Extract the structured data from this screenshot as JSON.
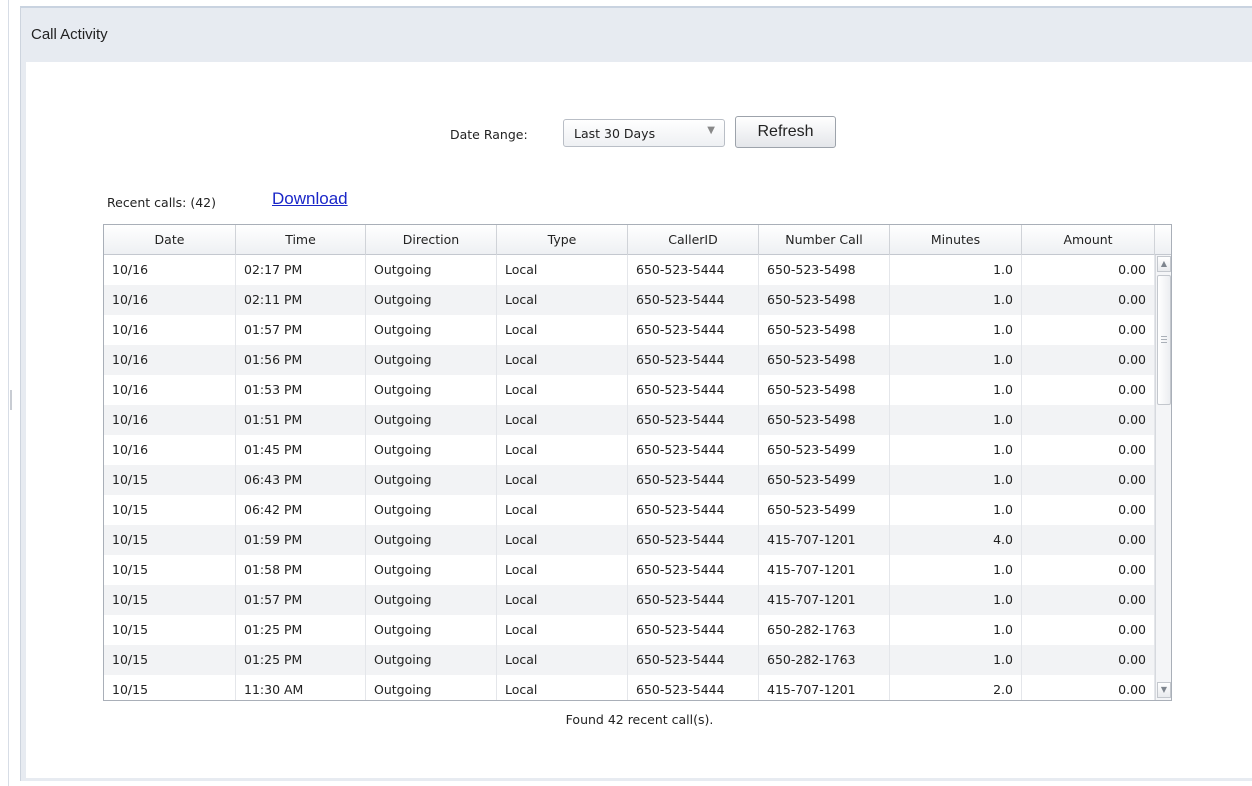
{
  "panel": {
    "title": "Call Activity"
  },
  "filters": {
    "date_range_label": "Date Range:",
    "date_range_value": "Last 30 Days",
    "refresh_label": "Refresh"
  },
  "summary": {
    "recent_calls_label": "Recent calls: (42)",
    "download_label": "Download",
    "found_text": "Found 42 recent call(s)."
  },
  "table": {
    "columns": [
      "Date",
      "Time",
      "Direction",
      "Type",
      "CallerID",
      "Number Call",
      "Minutes",
      "Amount"
    ],
    "rows": [
      [
        "10/16",
        "02:17 PM",
        "Outgoing",
        "Local",
        "650-523-5444",
        "650-523-5498",
        "1.0",
        "0.00"
      ],
      [
        "10/16",
        "02:11 PM",
        "Outgoing",
        "Local",
        "650-523-5444",
        "650-523-5498",
        "1.0",
        "0.00"
      ],
      [
        "10/16",
        "01:57 PM",
        "Outgoing",
        "Local",
        "650-523-5444",
        "650-523-5498",
        "1.0",
        "0.00"
      ],
      [
        "10/16",
        "01:56 PM",
        "Outgoing",
        "Local",
        "650-523-5444",
        "650-523-5498",
        "1.0",
        "0.00"
      ],
      [
        "10/16",
        "01:53 PM",
        "Outgoing",
        "Local",
        "650-523-5444",
        "650-523-5498",
        "1.0",
        "0.00"
      ],
      [
        "10/16",
        "01:51 PM",
        "Outgoing",
        "Local",
        "650-523-5444",
        "650-523-5498",
        "1.0",
        "0.00"
      ],
      [
        "10/16",
        "01:45 PM",
        "Outgoing",
        "Local",
        "650-523-5444",
        "650-523-5499",
        "1.0",
        "0.00"
      ],
      [
        "10/15",
        "06:43 PM",
        "Outgoing",
        "Local",
        "650-523-5444",
        "650-523-5499",
        "1.0",
        "0.00"
      ],
      [
        "10/15",
        "06:42 PM",
        "Outgoing",
        "Local",
        "650-523-5444",
        "650-523-5499",
        "1.0",
        "0.00"
      ],
      [
        "10/15",
        "01:59 PM",
        "Outgoing",
        "Local",
        "650-523-5444",
        "415-707-1201",
        "4.0",
        "0.00"
      ],
      [
        "10/15",
        "01:58 PM",
        "Outgoing",
        "Local",
        "650-523-5444",
        "415-707-1201",
        "1.0",
        "0.00"
      ],
      [
        "10/15",
        "01:57 PM",
        "Outgoing",
        "Local",
        "650-523-5444",
        "415-707-1201",
        "1.0",
        "0.00"
      ],
      [
        "10/15",
        "01:25 PM",
        "Outgoing",
        "Local",
        "650-523-5444",
        "650-282-1763",
        "1.0",
        "0.00"
      ],
      [
        "10/15",
        "01:25 PM",
        "Outgoing",
        "Local",
        "650-523-5444",
        "650-282-1763",
        "1.0",
        "0.00"
      ],
      [
        "10/15",
        "11:30 AM",
        "Outgoing",
        "Local",
        "650-523-5444",
        "415-707-1201",
        "2.0",
        "0.00"
      ]
    ]
  },
  "icons": {
    "dropdown": "chevron-down-icon",
    "scroll_up": "arrow-up-icon",
    "scroll_down": "arrow-down-icon"
  },
  "colors": {
    "panel_bg": "#e7ebf1",
    "link": "#1a26c8",
    "row_alt": "#f2f3f5"
  }
}
